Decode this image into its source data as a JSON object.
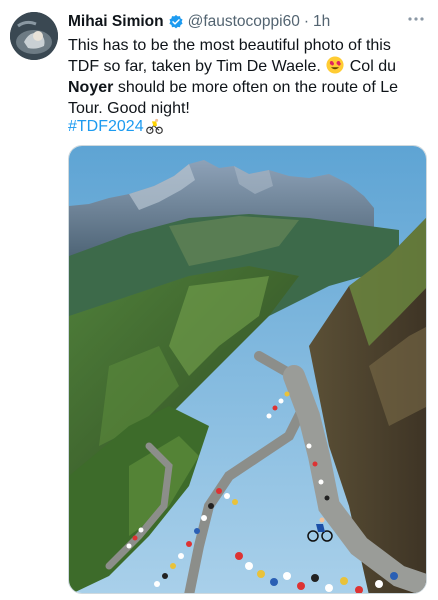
{
  "tweet": {
    "author_name": "Mihai Simion",
    "handle": "@faustocoppi60",
    "separator": "·",
    "time": "1h",
    "text_part1": "This has to be the most beautiful photo of this TDF so far, taken by Tim De Waele.",
    "text_part2": "Col du",
    "text_bold": "Noyer",
    "text_part3": "should be more often on the route of Le Tour. Good night!",
    "hashtag": "#TDF2024",
    "emoji_1": "smiling-face-with-heart-eyes",
    "emoji_2": "cyclist-yellow-jersey",
    "verified_color": "#1d9bf0",
    "link_color": "#1d9bf0"
  },
  "icons": {
    "more": "more-horizontal-icon",
    "verified": "verified-badge-icon"
  }
}
